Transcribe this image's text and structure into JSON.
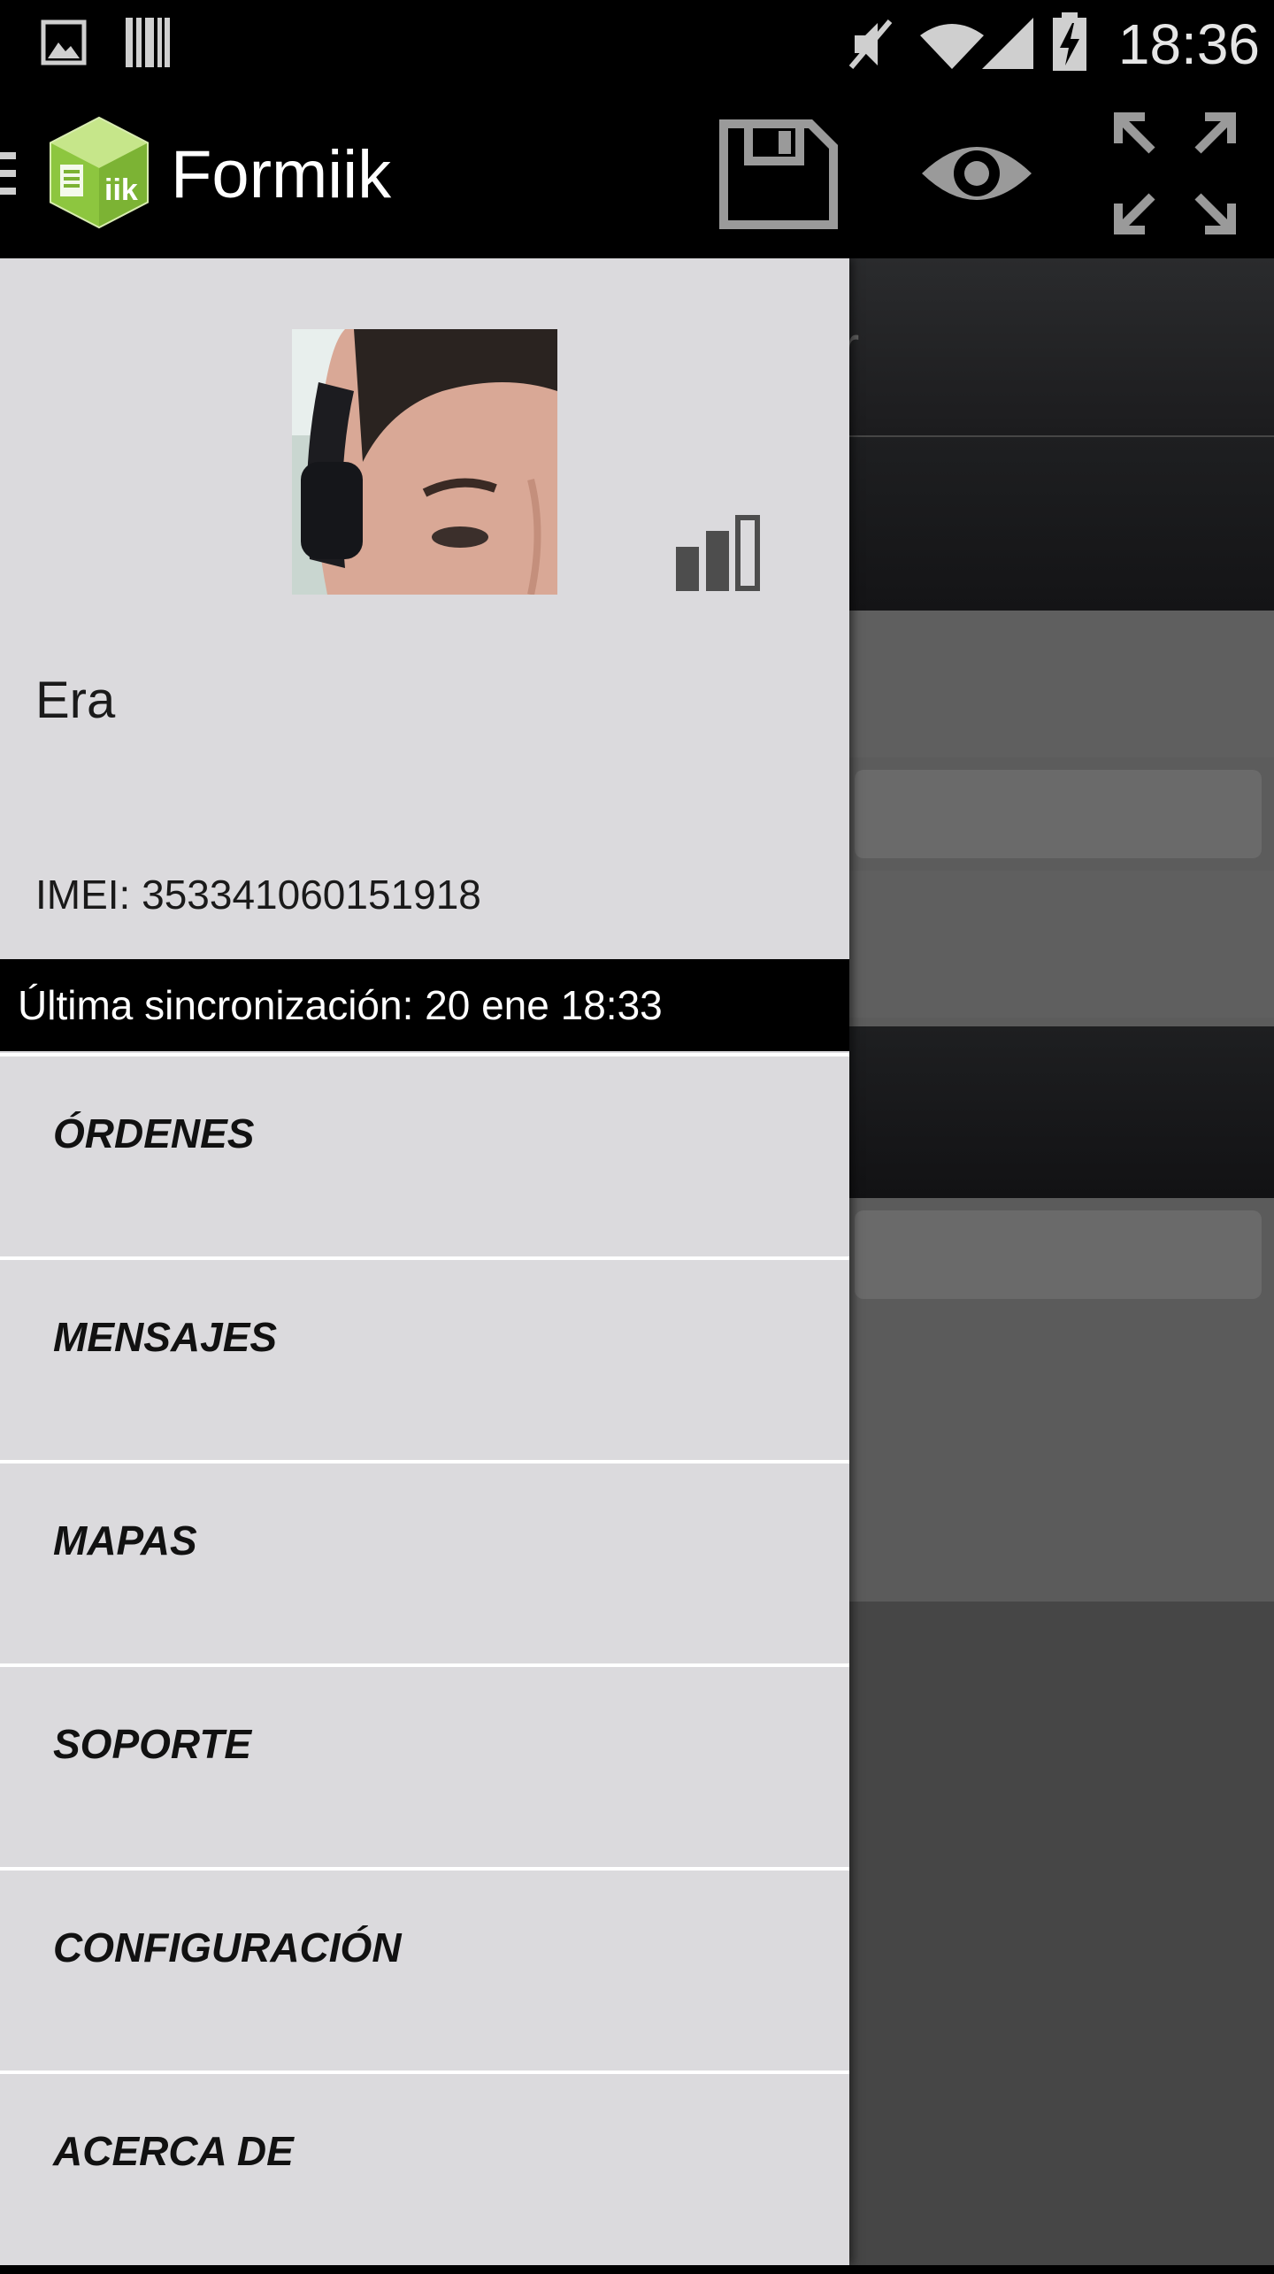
{
  "status_bar": {
    "time": "18:36",
    "icons": [
      "image-notification-icon",
      "barcode-notification-icon",
      "mute-icon",
      "wifi-icon",
      "cell-signal-icon",
      "battery-charging-icon"
    ]
  },
  "action_bar": {
    "app_title": "Formiik",
    "icons": [
      "menu-hamburger-icon",
      "formiik-logo-icon",
      "save-icon",
      "eye-icon",
      "fullscreen-icon"
    ]
  },
  "drawer": {
    "user_name": "Era",
    "imei": "IMEI: 353341060151918",
    "last_sync": "Última sincronización: 20 ene 18:33",
    "menu_items": [
      {
        "label": "ÓRDENES"
      },
      {
        "label": "MENSAJES"
      },
      {
        "label": "MAPAS"
      },
      {
        "label": "SOPORTE"
      },
      {
        "label": "CONFIGURACIÓN"
      },
      {
        "label": "ACERCA DE"
      }
    ]
  },
  "background": {
    "partial_letter": "r"
  },
  "colors": {
    "drawer_bg": "#dbdadd",
    "action_bar_bg": "#000000",
    "logo_green": "#8dc63f"
  }
}
